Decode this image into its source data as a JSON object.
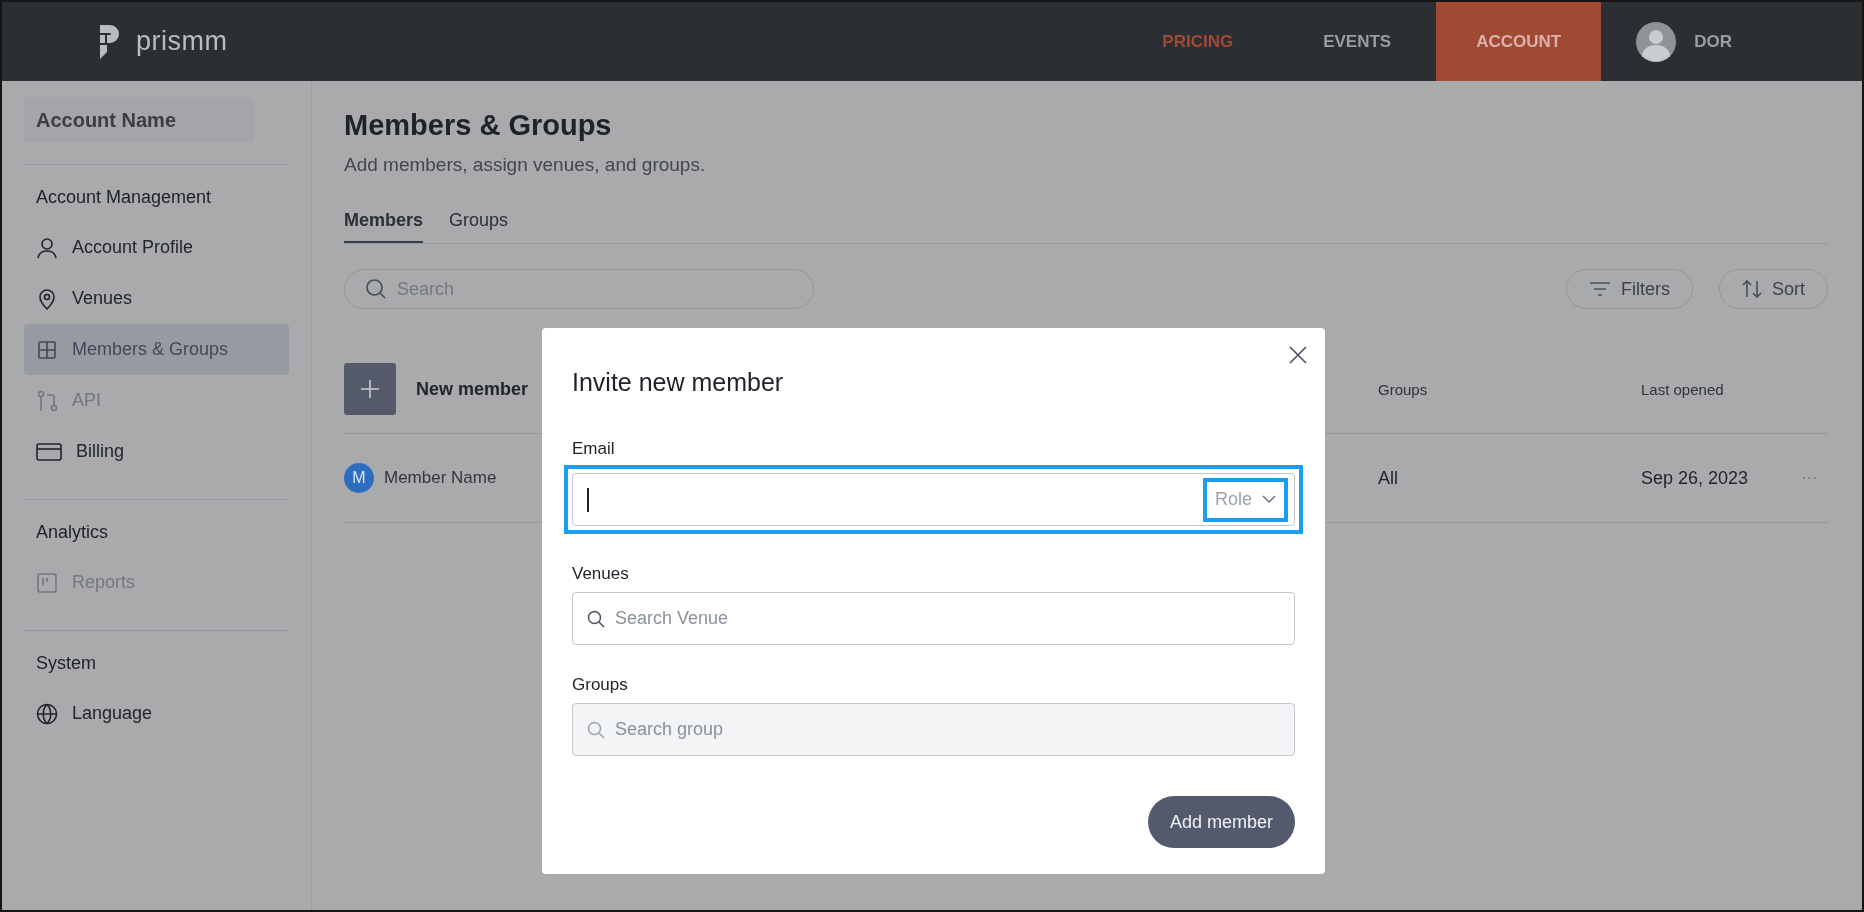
{
  "header": {
    "logo": "prismm",
    "nav": [
      {
        "label": "PRICING",
        "selected": false,
        "accent": true
      },
      {
        "label": "EVENTS",
        "selected": false,
        "accent": false
      },
      {
        "label": "ACCOUNT",
        "selected": true,
        "accent": false
      }
    ],
    "user": "DOR"
  },
  "sidebar": {
    "account_name": "Account Name",
    "sections": [
      {
        "title": "Account Management",
        "items": [
          {
            "label": "Account Profile",
            "selected": false,
            "disabled": false
          },
          {
            "label": "Venues",
            "selected": false,
            "disabled": false
          },
          {
            "label": "Members & Groups",
            "selected": true,
            "disabled": false
          },
          {
            "label": "API",
            "selected": false,
            "disabled": true
          },
          {
            "label": "Billing",
            "selected": false,
            "disabled": false
          }
        ]
      },
      {
        "title": "Analytics",
        "items": [
          {
            "label": "Reports",
            "selected": false,
            "disabled": true
          }
        ]
      },
      {
        "title": "System",
        "items": [
          {
            "label": "Language",
            "selected": false,
            "disabled": false
          }
        ]
      }
    ]
  },
  "page": {
    "title": "Members & Groups",
    "subtitle": "Add members, assign venues, and groups.",
    "tabs": [
      {
        "label": "Members",
        "selected": true
      },
      {
        "label": "Groups",
        "selected": false
      }
    ],
    "search": {
      "placeholder": "Search"
    },
    "filters_button": "Filters",
    "sort_button": "Sort"
  },
  "table": {
    "new_member": "New member",
    "columns": [
      "Groups",
      "Last opened"
    ],
    "rows": [
      {
        "initial": "M",
        "name": "Member Name",
        "groups": "All",
        "last_opened": "Sep 26, 2023",
        "menu": "···"
      }
    ]
  },
  "modal": {
    "title": "Invite new member",
    "email": {
      "label": "Email",
      "focused": true,
      "highlighted": true,
      "role": {
        "label": "Role",
        "highlighted": true
      }
    },
    "venues": {
      "label": "Venues",
      "placeholder": "Search Venue",
      "disabled": false
    },
    "groups": {
      "label": "Groups",
      "placeholder": "Search group",
      "disabled": true
    },
    "submit": "Add member"
  }
}
